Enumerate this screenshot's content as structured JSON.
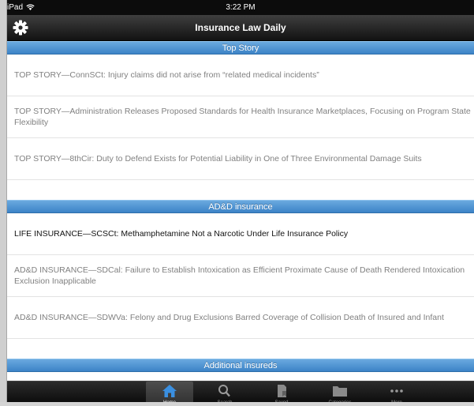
{
  "status_bar": {
    "carrier": "iPad",
    "wifi_icon": "wifi-icon",
    "time": "3:22 PM"
  },
  "nav": {
    "title": "Insurance Law Daily",
    "settings_icon": "gear-icon"
  },
  "sections": [
    {
      "title": "Top Story",
      "items": [
        "TOP STORY—ConnSCt: Injury claims did not arise from “related medical incidents”",
        "TOP STORY—Administration Releases Proposed Standards for Health Insurance Marketplaces, Focusing on Program State Flexibility",
        "TOP STORY—8thCir: Duty to Defend Exists for Potential Liability in One of Three Environmental Damage Suits"
      ]
    },
    {
      "title": "AD&D insurance",
      "items": [
        "LIFE INSURANCE—SCSCt: Methamphetamine Not a Narcotic Under Life Insurance Policy",
        "AD&D INSURANCE—SDCal: Failure to Establish Intoxication as Efficient Proximate Cause of Death Rendered Intoxication Exclusion Inapplicable",
        "AD&D INSURANCE—SDWVa: Felony and Drug Exclusions Barred Coverage of Collision Death of Insured and Infant"
      ]
    },
    {
      "title": "Additional insureds",
      "items": []
    }
  ],
  "tabs": [
    {
      "label": "Home",
      "icon": "home-icon",
      "active": true
    },
    {
      "label": "Search",
      "icon": "search-icon",
      "active": false
    },
    {
      "label": "Saved",
      "icon": "saved-icon",
      "active": false
    },
    {
      "label": "Categories",
      "icon": "folder-icon",
      "active": false
    },
    {
      "label": "More",
      "icon": "more-icon",
      "active": false
    }
  ],
  "colors": {
    "section_header": "#4a90d2",
    "nav_bar": "#1c1c1c",
    "tab_bar": "#111111"
  }
}
